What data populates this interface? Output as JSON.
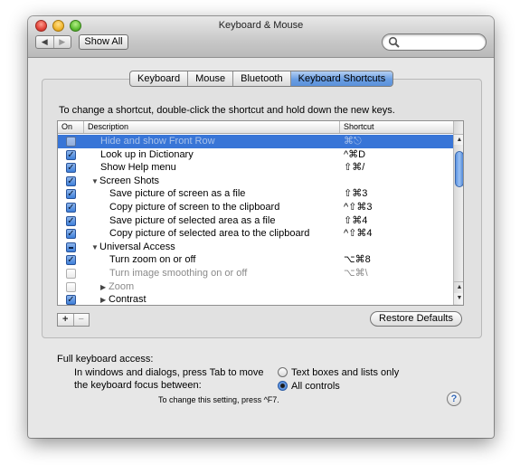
{
  "window": {
    "title": "Keyboard & Mouse",
    "nav": {
      "back_glyph": "◀",
      "forward_glyph": "▶"
    },
    "show_all_label": "Show All",
    "search": {
      "value": "",
      "placeholder": "",
      "icon": "magnifier-icon"
    }
  },
  "tabs": [
    {
      "label": "Keyboard",
      "active": false
    },
    {
      "label": "Mouse",
      "active": false
    },
    {
      "label": "Bluetooth",
      "active": false
    },
    {
      "label": "Keyboard Shortcuts",
      "active": true
    }
  ],
  "instruction": "To change a shortcut, double-click the shortcut and hold down the new keys.",
  "table": {
    "columns": {
      "on": "On",
      "description": "Description",
      "shortcut": "Shortcut"
    },
    "rows": [
      {
        "state": "unchecked",
        "disclosure": "",
        "indent": 1,
        "description": "Hide and show Front Row",
        "shortcut": "⌘⎋",
        "dim": true,
        "selected": true
      },
      {
        "state": "checked",
        "disclosure": "",
        "indent": 1,
        "description": "Look up in Dictionary",
        "shortcut": "^⌘D",
        "dim": false,
        "selected": false
      },
      {
        "state": "checked",
        "disclosure": "",
        "indent": 1,
        "description": "Show Help menu",
        "shortcut": "⇧⌘/",
        "dim": false,
        "selected": false
      },
      {
        "state": "checked",
        "disclosure": "▼",
        "indent": 0,
        "description": "Screen Shots",
        "shortcut": "",
        "dim": false,
        "selected": false
      },
      {
        "state": "checked",
        "disclosure": "",
        "indent": 2,
        "description": "Save picture of screen as a file",
        "shortcut": "⇧⌘3",
        "dim": false,
        "selected": false
      },
      {
        "state": "checked",
        "disclosure": "",
        "indent": 2,
        "description": "Copy picture of screen to the clipboard",
        "shortcut": "^⇧⌘3",
        "dim": false,
        "selected": false
      },
      {
        "state": "checked",
        "disclosure": "",
        "indent": 2,
        "description": "Save picture of selected area as a file",
        "shortcut": "⇧⌘4",
        "dim": false,
        "selected": false
      },
      {
        "state": "checked",
        "disclosure": "",
        "indent": 2,
        "description": "Copy picture of selected area to the clipboard",
        "shortcut": "^⇧⌘4",
        "dim": false,
        "selected": false
      },
      {
        "state": "mixed",
        "disclosure": "▼",
        "indent": 0,
        "description": "Universal Access",
        "shortcut": "",
        "dim": false,
        "selected": false
      },
      {
        "state": "checked",
        "disclosure": "",
        "indent": 2,
        "description": "Turn zoom on or off",
        "shortcut": "⌥⌘8",
        "dim": false,
        "selected": false
      },
      {
        "state": "unchecked",
        "disclosure": "",
        "indent": 2,
        "description": "Turn image smoothing on or off",
        "shortcut": "⌥⌘\\",
        "dim": true,
        "selected": false
      },
      {
        "state": "unchecked",
        "disclosure": "▶",
        "indent": 1,
        "description": "Zoom",
        "shortcut": "",
        "dim": true,
        "selected": false
      },
      {
        "state": "checked",
        "disclosure": "▶",
        "indent": 1,
        "description": "Contrast",
        "shortcut": "",
        "dim": false,
        "selected": false
      }
    ],
    "scroll": {
      "up_glyph": "▲",
      "down_glyph": "▼",
      "position": 0.25
    }
  },
  "buttons": {
    "add": "+",
    "remove": "−",
    "restore_defaults": "Restore Defaults"
  },
  "full_keyboard_access": {
    "label": "Full keyboard access:",
    "text": "In windows and dialogs, press Tab to move the keyboard focus between:",
    "options": [
      {
        "label": "Text boxes and lists only",
        "selected": false
      },
      {
        "label": "All controls",
        "selected": true
      }
    ],
    "note": "To change this setting, press ^F7."
  },
  "help_label": "?",
  "colors": {
    "selection": "#3875d7",
    "accent": "#3e7fd9"
  }
}
